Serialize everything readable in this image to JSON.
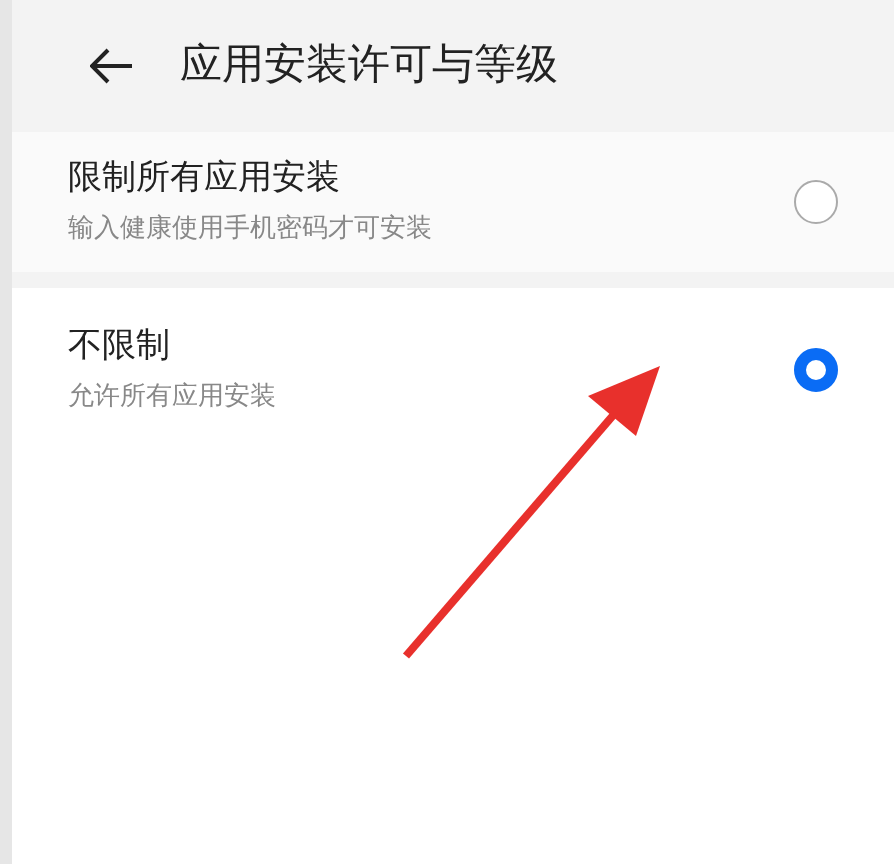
{
  "header": {
    "title": "应用安装许可与等级"
  },
  "options": [
    {
      "title": "限制所有应用安装",
      "subtitle": "输入健康使用手机密码才可安装",
      "selected": false
    },
    {
      "title": "不限制",
      "subtitle": "允许所有应用安装",
      "selected": true
    }
  ]
}
